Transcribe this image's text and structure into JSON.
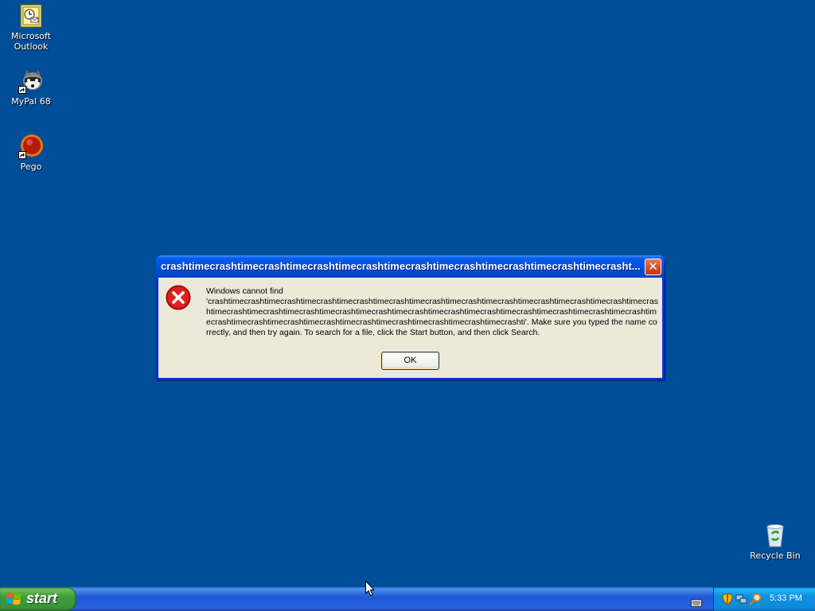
{
  "desktop": {
    "icons": [
      {
        "label": "Microsoft Outlook",
        "icon": "outlook-icon"
      },
      {
        "label": "MyPal 68",
        "icon": "raccoon-browser-icon"
      },
      {
        "label": "Pego",
        "icon": "pego-icon"
      },
      {
        "label": "Recycle Bin",
        "icon": "recycle-bin-icon"
      }
    ]
  },
  "dialog": {
    "title": "crashtimecrashtimecrashtimecrashtimecrashtimecrashtimecrashtimecrashtimecrashtimecrasht...",
    "message_intro": "Windows cannot find",
    "message_body": "'crashtimecrashtimecrashtimecrashtimecrashtimecrashtimecrashtimecrashtimecrashtimecrashtimecrashtimecrashtimecrashtimecrashtimecrashtimecrashtimecrashtimecrashtimecrashtimecrashtimecrashtimecrashtimecrashtimecrashtimecrashtimecrashtimecrashtimecrashtimecrashtimecrashtimecrashtimecrashtimecrashtimecrashti'. Make sure you typed the name correctly, and then try again. To search for a file, click the Start button, and then click Search.",
    "ok_label": "OK",
    "close_label": "✕",
    "icon": "error-icon"
  },
  "taskbar": {
    "start_label": "start",
    "clock": "5:33 PM",
    "tray_icons": [
      "security-shield-icon",
      "network-icon",
      "search-icon"
    ],
    "keyboard_icon": "keyboard-icon"
  },
  "colors": {
    "desktop": "#004e98",
    "titlebar": "#0054e3",
    "dialog_body": "#ece9d8",
    "start_button": "#3a933a",
    "close_button": "#d34a1c"
  }
}
